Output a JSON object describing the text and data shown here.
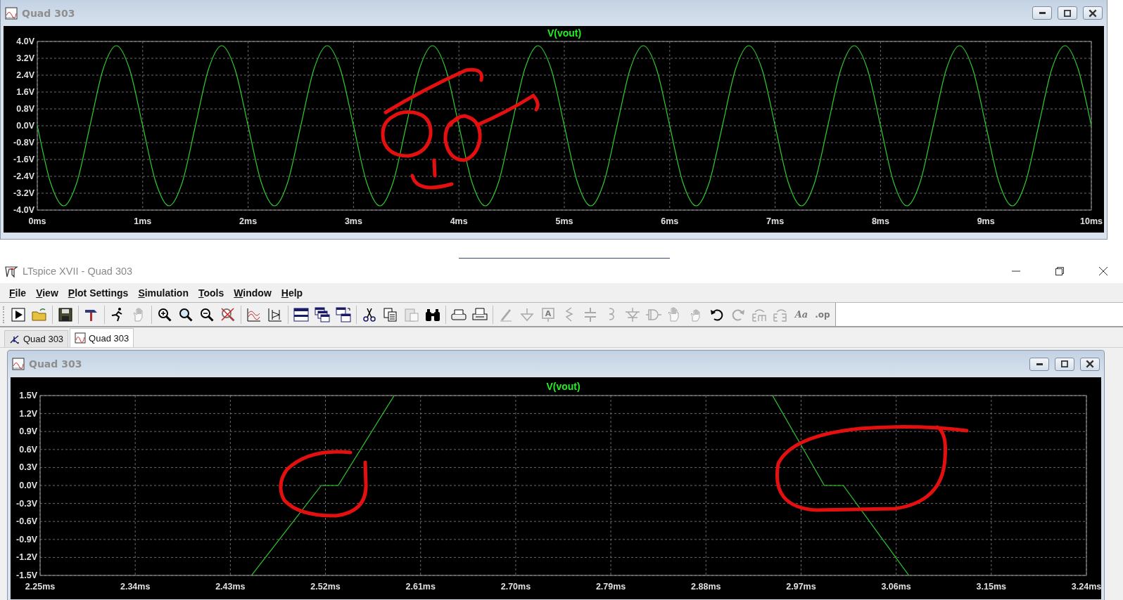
{
  "plot_window": {
    "title": "Quad 303",
    "chart_data": {
      "type": "line",
      "xlim": [
        0,
        10
      ],
      "ylim": [
        -4,
        4
      ],
      "grid": true,
      "x": [
        0,
        0.125,
        0.25,
        0.375,
        0.5,
        0.625,
        0.75,
        0.875,
        1,
        1.125,
        1.25,
        1.375,
        1.5,
        1.625,
        1.75,
        1.875,
        2,
        2.125,
        2.25,
        2.375,
        2.5,
        2.625,
        2.75,
        2.875,
        3,
        3.125,
        3.25,
        3.375,
        3.5,
        3.625,
        3.75,
        3.875,
        4,
        4.125,
        4.25,
        4.375,
        4.5,
        4.625,
        4.75,
        4.875,
        5,
        5.125,
        5.25,
        5.375,
        5.5,
        5.625,
        5.75,
        5.875,
        6,
        6.125,
        6.25,
        6.375,
        6.5,
        6.625,
        6.75,
        6.875,
        7,
        7.125,
        7.25,
        7.375,
        7.5,
        7.625,
        7.75,
        7.875,
        8,
        8.125,
        8.25,
        8.375,
        8.5,
        8.625,
        8.75,
        8.875,
        9,
        9.125,
        9.25,
        9.375,
        9.5,
        9.625,
        9.75,
        9.875,
        10
      ],
      "series": [
        {
          "name": "V(vout)",
          "color": "#2ecc2e",
          "values": [
            0,
            -2.69,
            -3.8,
            -2.69,
            0,
            2.69,
            3.8,
            2.69,
            0,
            -2.69,
            -3.8,
            -2.69,
            0,
            2.69,
            3.8,
            2.69,
            0,
            -2.69,
            -3.8,
            -2.69,
            0,
            2.69,
            3.8,
            2.69,
            0,
            -2.69,
            -3.8,
            -2.69,
            0,
            2.69,
            3.8,
            2.69,
            0,
            -2.69,
            -3.8,
            -2.69,
            0,
            2.69,
            3.8,
            2.69,
            0,
            -2.69,
            -3.8,
            -2.69,
            0,
            2.69,
            3.8,
            2.69,
            0,
            -2.69,
            -3.8,
            -2.69,
            0,
            2.69,
            3.8,
            2.69,
            0,
            -2.69,
            -3.8,
            -2.69,
            0,
            2.69,
            3.8,
            2.69,
            0,
            -2.69,
            -3.8,
            -2.69,
            0,
            2.69,
            3.8,
            2.69,
            0,
            -2.69,
            -3.8,
            -2.69,
            0,
            2.69,
            3.8,
            2.69,
            0
          ]
        }
      ],
      "xticks": [
        {
          "value": 0,
          "label": "0ms"
        },
        {
          "value": 1,
          "label": "1ms"
        },
        {
          "value": 2,
          "label": "2ms"
        },
        {
          "value": 3,
          "label": "3ms"
        },
        {
          "value": 4,
          "label": "4ms"
        },
        {
          "value": 5,
          "label": "5ms"
        },
        {
          "value": 6,
          "label": "6ms"
        },
        {
          "value": 7,
          "label": "7ms"
        },
        {
          "value": 8,
          "label": "8ms"
        },
        {
          "value": 9,
          "label": "9ms"
        },
        {
          "value": 10,
          "label": "10ms"
        }
      ],
      "yticks": [
        {
          "value": 4,
          "label": "4.0V"
        },
        {
          "value": 3.2,
          "label": "3.2V"
        },
        {
          "value": 2.4,
          "label": "2.4V"
        },
        {
          "value": 1.6,
          "label": "1.6V"
        },
        {
          "value": 0.8,
          "label": "0.8V"
        },
        {
          "value": 0,
          "label": "0.0V"
        },
        {
          "value": -0.8,
          "label": "-0.8V"
        },
        {
          "value": -1.6,
          "label": "-1.6V"
        },
        {
          "value": -2.4,
          "label": "-2.4V"
        },
        {
          "value": -3.2,
          "label": "-3.2V"
        },
        {
          "value": -4,
          "label": "-4.0V"
        }
      ]
    }
  },
  "app": {
    "title": "LTspice XVII - Quad 303",
    "menu": [
      "File",
      "View",
      "Plot Settings",
      "Simulation",
      "Tools",
      "Window",
      "Help"
    ],
    "toolbar": [
      {
        "kind": "run",
        "disabled": false
      },
      {
        "kind": "open",
        "disabled": false
      },
      {
        "kind": "sep"
      },
      {
        "kind": "save",
        "disabled": false
      },
      {
        "kind": "sep"
      },
      {
        "kind": "hammer",
        "disabled": false
      },
      {
        "kind": "sep"
      },
      {
        "kind": "runner",
        "disabled": false
      },
      {
        "kind": "hand",
        "disabled": true
      },
      {
        "kind": "sep"
      },
      {
        "kind": "zoom-in",
        "disabled": false
      },
      {
        "kind": "zoom",
        "disabled": false
      },
      {
        "kind": "zoom-out",
        "disabled": false
      },
      {
        "kind": "zoom-cancel",
        "disabled": false
      },
      {
        "kind": "sep"
      },
      {
        "kind": "autorange",
        "disabled": false
      },
      {
        "kind": "cursor",
        "disabled": false
      },
      {
        "kind": "sep"
      },
      {
        "kind": "tile-h",
        "disabled": false
      },
      {
        "kind": "cascade",
        "disabled": false
      },
      {
        "kind": "tile-v",
        "disabled": false
      },
      {
        "kind": "sep"
      },
      {
        "kind": "cut",
        "disabled": false
      },
      {
        "kind": "copy",
        "disabled": false
      },
      {
        "kind": "paste",
        "disabled": true
      },
      {
        "kind": "find",
        "disabled": false
      },
      {
        "kind": "sep"
      },
      {
        "kind": "print",
        "disabled": false
      },
      {
        "kind": "print-setup",
        "disabled": false
      },
      {
        "kind": "sep"
      },
      {
        "kind": "pencil",
        "disabled": true
      },
      {
        "kind": "ground",
        "disabled": true
      },
      {
        "kind": "label",
        "disabled": true,
        "glyph": "A"
      },
      {
        "kind": "resistor",
        "disabled": true
      },
      {
        "kind": "capacitor",
        "disabled": true
      },
      {
        "kind": "inductor",
        "disabled": true
      },
      {
        "kind": "diode",
        "disabled": true
      },
      {
        "kind": "component",
        "disabled": true
      },
      {
        "kind": "move",
        "disabled": true
      },
      {
        "kind": "drag",
        "disabled": true
      },
      {
        "kind": "undo",
        "disabled": false
      },
      {
        "kind": "redo",
        "disabled": true
      },
      {
        "kind": "mirror",
        "disabled": true
      },
      {
        "kind": "rotate",
        "disabled": true
      },
      {
        "kind": "text",
        "disabled": true,
        "glyph": "Aa"
      },
      {
        "kind": "directive",
        "disabled": true,
        "glyph": ".op"
      }
    ],
    "tabs": [
      {
        "label": "Quad 303",
        "kind": "schematic",
        "selected": false
      },
      {
        "label": "Quad 303",
        "kind": "waveform",
        "selected": true
      }
    ],
    "plot_window": {
      "title": "Quad 303",
      "chart_data": {
        "type": "line",
        "xlim": [
          2.25,
          3.24
        ],
        "ylim": [
          -1.5,
          1.5
        ],
        "x": [
          2.45,
          2.516,
          2.532,
          2.585,
          2.943,
          2.992,
          3.01,
          3.072
        ],
        "grid": true,
        "series": [
          {
            "name": "V(vout)",
            "color": "#2ecc2e",
            "values": [
              -1.5,
              0,
              0,
              1.5,
              1.5,
              0,
              0,
              -1.5
            ]
          }
        ],
        "xticks": [
          {
            "value": 2.25,
            "label": "2.25ms"
          },
          {
            "value": 2.34,
            "label": "2.34ms"
          },
          {
            "value": 2.43,
            "label": "2.43ms"
          },
          {
            "value": 2.52,
            "label": "2.52ms"
          },
          {
            "value": 2.61,
            "label": "2.61ms"
          },
          {
            "value": 2.7,
            "label": "2.70ms"
          },
          {
            "value": 2.79,
            "label": "2.79ms"
          },
          {
            "value": 2.88,
            "label": "2.88ms"
          },
          {
            "value": 2.97,
            "label": "2.97ms"
          },
          {
            "value": 3.06,
            "label": "3.06ms"
          },
          {
            "value": 3.15,
            "label": "3.15ms"
          },
          {
            "value": 3.24,
            "label": "3.24ms"
          }
        ],
        "yticks": [
          {
            "value": 1.5,
            "label": "1.5V"
          },
          {
            "value": 1.2,
            "label": "1.2V"
          },
          {
            "value": 0.9,
            "label": "0.9V"
          },
          {
            "value": 0.6,
            "label": "0.6V"
          },
          {
            "value": 0.3,
            "label": "0.3V"
          },
          {
            "value": 0,
            "label": "0.0V"
          },
          {
            "value": -0.3,
            "label": "-0.3V"
          },
          {
            "value": -0.6,
            "label": "-0.6V"
          },
          {
            "value": -0.9,
            "label": "-0.9V"
          },
          {
            "value": -1.2,
            "label": "-1.2V"
          },
          {
            "value": -1.5,
            "label": "-1.5V"
          }
        ]
      }
    }
  }
}
